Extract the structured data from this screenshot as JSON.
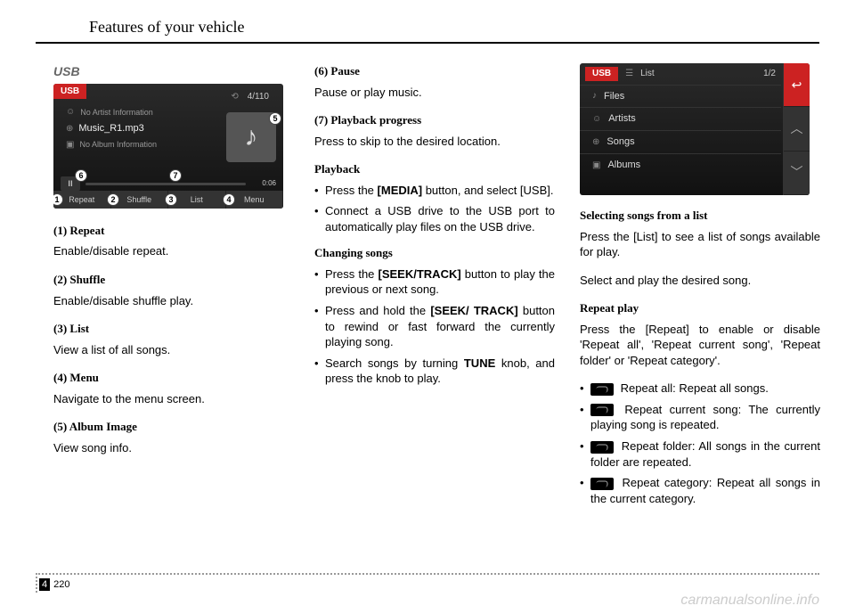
{
  "header": "Features of your vehicle",
  "col1": {
    "title": "USB",
    "screen": {
      "title": "USB",
      "loop_icon": "⟲",
      "counter": "4/110",
      "artist": "No Artist Information",
      "track": "Music_R1.mp3",
      "album": "No Album Information",
      "time_start": "",
      "time_end": "0:06",
      "pause_glyph": "II",
      "note_glyph": "♪",
      "buttons": [
        "Repeat",
        "Shuffle",
        "List",
        "Menu"
      ],
      "callouts": [
        "1",
        "2",
        "3",
        "4",
        "5",
        "6",
        "7"
      ]
    },
    "items": [
      {
        "h": "(1) Repeat",
        "t": "Enable/disable repeat."
      },
      {
        "h": "(2) Shuffle",
        "t": "Enable/disable shuffle play."
      },
      {
        "h": "(3) List",
        "t": "View a list of all songs."
      },
      {
        "h": "(4) Menu",
        "t": "Navigate to the menu screen."
      },
      {
        "h": "(5) Album Image",
        "t": "View song info."
      }
    ]
  },
  "col2": {
    "h6": "(6) Pause",
    "t6": "Pause or play music.",
    "h7": "(7) Playback progress",
    "t7": "Press to skip to the desired location.",
    "playback_h": "Playback",
    "playback": [
      "Press the [MEDIA] button, and select [USB].",
      "Connect a USB drive to the USB port to automatically play files on the USB drive."
    ],
    "changing_h": "Changing songs",
    "changing": [
      "Press the [SEEK/TRACK] button to play the previous or next song.",
      "Press and hold the [SEEK/ TRACK] button to rewind or fast forward the currently playing song.",
      "Search songs by turning TUNE knob, and press the knob to play."
    ]
  },
  "col3": {
    "screen": {
      "title": "USB",
      "list_label": "List",
      "counter": "1/2",
      "list_glyph": "☰",
      "back_glyph": "↩",
      "up_glyph": "︿",
      "down_glyph": "﹀",
      "rows": [
        {
          "icon": "♪",
          "label": "Files"
        },
        {
          "icon": "☺",
          "label": "Artists"
        },
        {
          "icon": "⊕",
          "label": "Songs"
        },
        {
          "icon": "▣",
          "label": "Albums"
        }
      ]
    },
    "sel_h": "Selecting songs from a list",
    "sel_t1": "Press the [List] to see a list of songs available for play.",
    "sel_t2": "Select and play the desired song.",
    "rep_h": "Repeat play",
    "rep_t": "Press the [Repeat] to enable or disable 'Repeat all', 'Repeat current song', 'Repeat folder' or 'Repeat category'.",
    "rep_items": [
      "Repeat all: Repeat all songs.",
      "Repeat current song: The currently playing song is repeated.",
      "Repeat folder: All songs in the current folder are repeated.",
      "Repeat category: Repeat all songs in the current category."
    ]
  },
  "footer": {
    "chapter": "4",
    "page": "220"
  },
  "watermark": "carmanualsonline.info"
}
